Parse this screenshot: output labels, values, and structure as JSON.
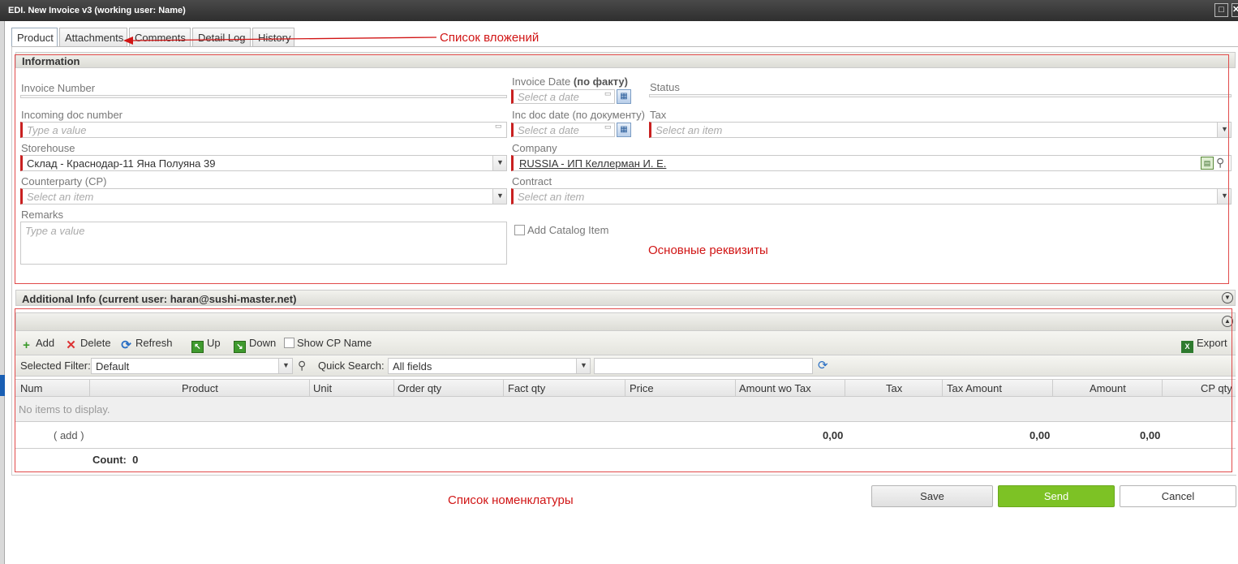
{
  "window": {
    "title": "EDI. New Invoice v3 (working user: Name)",
    "maximize_glyph": "□",
    "close_glyph": "✕"
  },
  "tabs": [
    {
      "label": "Product"
    },
    {
      "label": "Attachments"
    },
    {
      "label": "Comments"
    },
    {
      "label": "Detail Log"
    },
    {
      "label": "History"
    }
  ],
  "annotations": {
    "attachments": "Список вложений",
    "requisites": "Основные реквизиты",
    "nomenclature": "Список номенклатуры"
  },
  "info": {
    "header": "Information",
    "invoice_number_label": "Invoice Number",
    "invoice_date_label": "Invoice Date",
    "invoice_date_suffix": "(по факту)",
    "invoice_date_placeholder": "Select a date",
    "status_label": "Status",
    "incoming_label": "Incoming doc number",
    "incoming_placeholder": "Type a value",
    "inc_date_label": "Inc doc date (по документу)",
    "inc_date_placeholder": "Select a date",
    "tax_label": "Tax",
    "tax_placeholder": "Select an item",
    "storehouse_label": "Storehouse",
    "storehouse_value": "Склад - Краснодар-11 Яна Полуяна 39",
    "company_label": "Company",
    "company_value": "RUSSIA - ИП Келлерман И. Е.",
    "counterparty_label": "Counterparty (CP)",
    "counterparty_placeholder": "Select an item",
    "contract_label": "Contract",
    "contract_placeholder": "Select an item",
    "remarks_label": "Remarks",
    "remarks_placeholder": "Type a value",
    "add_catalog_label": "Add Catalog Item"
  },
  "additional": {
    "header": "Additional Info (current user: haran@sushi-master.net)"
  },
  "toolbar": {
    "add": "Add",
    "delete": "Delete",
    "refresh": "Refresh",
    "up": "Up",
    "down": "Down",
    "show_cp": "Show CP Name",
    "export": "Export"
  },
  "filter": {
    "selected_filter_label": "Selected Filter:",
    "selected_filter_value": "Default",
    "quick_search_label": "Quick Search:",
    "quick_search_value": "All fields",
    "search_text": ""
  },
  "grid": {
    "columns": [
      "Num",
      "Product",
      "Unit",
      "Order qty",
      "Fact qty",
      "Price",
      "Amount wo Tax",
      "Tax",
      "Tax Amount",
      "Amount",
      "CP qty"
    ],
    "empty_text": "No items to display.",
    "add_link": "( add )",
    "totals": {
      "amount_wo_tax": "0,00",
      "tax_amount": "0,00",
      "amount": "0,00"
    },
    "count_label": "Count:",
    "count_value": "0"
  },
  "footer": {
    "save": "Save",
    "send": "Send",
    "cancel": "Cancel"
  },
  "colors": {
    "send_green": "#7dc225",
    "required_red": "#c92020",
    "annotation_red": "#d11515"
  }
}
